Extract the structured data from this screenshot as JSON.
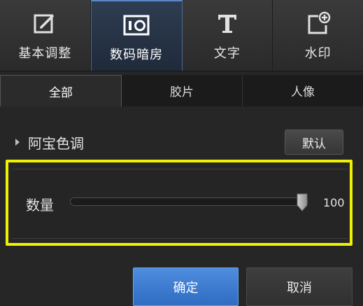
{
  "toolbar": {
    "items": [
      {
        "label": "基本调整",
        "icon": "edit-icon"
      },
      {
        "label": "数码暗房",
        "icon": "camera-icon",
        "active": true
      },
      {
        "label": "文字",
        "icon": "text-icon"
      },
      {
        "label": "水印",
        "icon": "add-watermark-icon"
      }
    ]
  },
  "tabs": [
    {
      "label": "全部",
      "active": true
    },
    {
      "label": "胶片"
    },
    {
      "label": "人像"
    }
  ],
  "section": {
    "title": "阿宝色调",
    "default_label": "默认"
  },
  "slider": {
    "label": "数量",
    "value": 100,
    "value_text": "100",
    "min": 0,
    "max": 100
  },
  "buttons": {
    "ok": "确定",
    "cancel": "取消"
  },
  "colors": {
    "accent": "#3f7fd4",
    "highlight": "#eef200",
    "background": "#262626"
  }
}
